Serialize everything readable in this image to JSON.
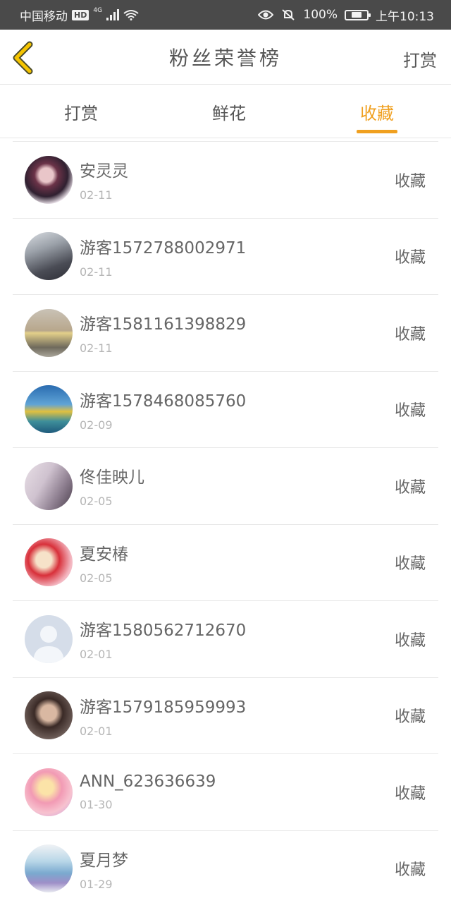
{
  "status_bar": {
    "carrier": "中国移动",
    "hd": "HD",
    "network": "4G",
    "battery_pct": "100%",
    "time": "上午10:13",
    "icons": [
      "signal-icon",
      "wifi-icon",
      "eye-icon",
      "bell-off-icon",
      "battery-icon"
    ]
  },
  "header": {
    "title": "粉丝荣誉榜",
    "action": "打赏"
  },
  "tabs": [
    {
      "label": "打赏",
      "active": false
    },
    {
      "label": "鲜花",
      "active": false
    },
    {
      "label": "收藏",
      "active": true
    }
  ],
  "accent_color": "#f0a020",
  "list": {
    "items": [
      {
        "name": "安灵灵",
        "date": "02-11",
        "action": "收藏"
      },
      {
        "name": "游客1572788002971",
        "date": "02-11",
        "action": "收藏"
      },
      {
        "name": "游客1581161398829",
        "date": "02-11",
        "action": "收藏"
      },
      {
        "name": "游客1578468085760",
        "date": "02-09",
        "action": "收藏"
      },
      {
        "name": "佟佳映儿",
        "date": "02-05",
        "action": "收藏"
      },
      {
        "name": "夏安椿",
        "date": "02-05",
        "action": "收藏"
      },
      {
        "name": "游客1580562712670",
        "date": "02-01",
        "action": "收藏"
      },
      {
        "name": "游客1579185959993",
        "date": "02-01",
        "action": "收藏"
      },
      {
        "name": "ANN_623636639",
        "date": "01-30",
        "action": "收藏"
      },
      {
        "name": "夏月梦",
        "date": "01-29",
        "action": "收藏"
      }
    ]
  }
}
